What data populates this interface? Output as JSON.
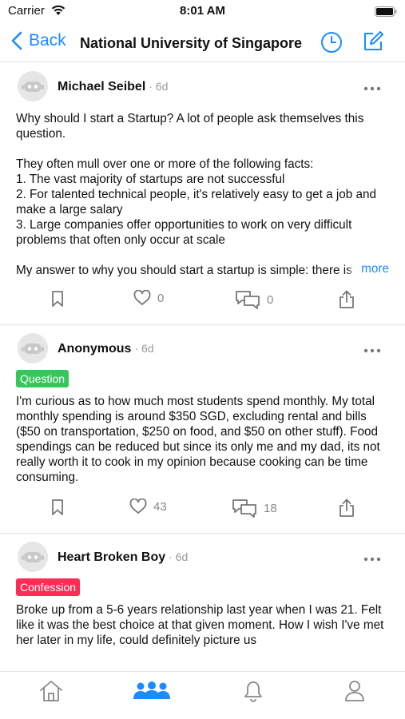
{
  "status": {
    "carrier": "Carrier",
    "time": "8:01 AM"
  },
  "nav": {
    "back_label": "Back",
    "title": "National University of Singapore"
  },
  "posts": [
    {
      "author": "Michael Seibel",
      "age": "· 6d",
      "tag": "",
      "body": "Why should I start a Startup? A lot of people ask themselves this question.\n\nThey often mull over one or more of the following facts:\n1. The vast majority of startups are not successful\n2. For talented technical people, it's relatively easy to get a job and make a large salary\n3. Large companies offer opportunities to work on very difficult problems that often only occur at scale\n\nMy answer to why you should start a startup is simple: there is a certain type of person who only works at their peak cap",
      "more_label": "more",
      "likes": "0",
      "comments": "0"
    },
    {
      "author": "Anonymous",
      "age": "· 6d",
      "tag": "Question",
      "body": "I'm curious as to how much most students spend monthly. My total monthly spending is around $350 SGD, excluding rental and bills ($50 on transportation, $250 on food, and $50 on other stuff). Food spendings can be reduced but since its only me and my dad, its not really worth it to cook in my opinion because cooking can be time consuming.",
      "likes": "43",
      "comments": "18"
    },
    {
      "author": "Heart Broken Boy",
      "age": "· 6d",
      "tag": "Confession",
      "body": "Broke up from a 5-6 years relationship last year when I was 21. Felt like it was the best choice at that given moment. How I wish I've met her later in my life, could definitely picture us"
    }
  ],
  "colors": {
    "accent": "#1a8cff",
    "question": "#34c759",
    "confession": "#ff2d55"
  },
  "tabs": [
    "home-icon",
    "groups-icon",
    "bell-icon",
    "profile-icon"
  ]
}
